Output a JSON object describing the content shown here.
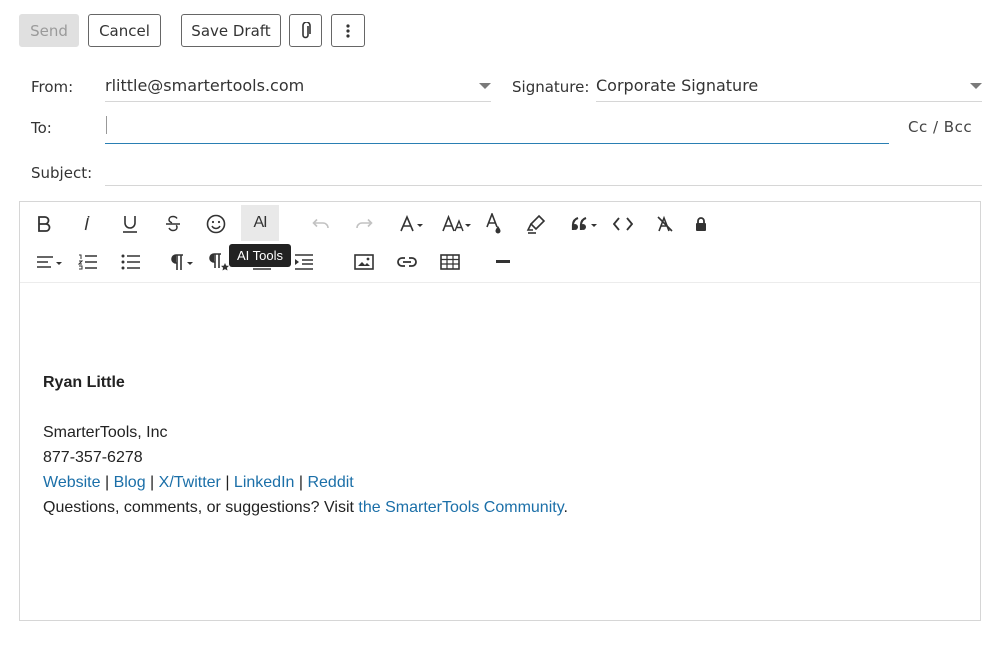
{
  "actions": {
    "send": "Send",
    "cancel": "Cancel",
    "save_draft": "Save Draft",
    "attach_icon": "paperclip-icon",
    "more_icon": "vertical-ellipsis-icon"
  },
  "header": {
    "from_label": "From:",
    "from_value": "rlittle@smartertools.com",
    "signature_label": "Signature:",
    "signature_value": "Corporate Signature",
    "to_label": "To:",
    "to_value": "",
    "cc_bcc": "Cc / Bcc",
    "subject_label": "Subject:",
    "subject_value": ""
  },
  "toolbar": {
    "tooltip": "AI Tools",
    "ai_label": "AI"
  },
  "signature": {
    "name": "Ryan Little",
    "company": "SmarterTools, Inc",
    "phone": "877-357-6278",
    "links": [
      "Website",
      "Blog",
      "X/Twitter",
      "LinkedIn",
      "Reddit"
    ],
    "separator": " | ",
    "community_prefix": "Questions, comments, or suggestions? Visit ",
    "community_link": "the SmarterTools Community",
    "community_suffix": "."
  },
  "colors": {
    "link": "#1b6fa8",
    "focus_underline": "#2a7fb3"
  }
}
